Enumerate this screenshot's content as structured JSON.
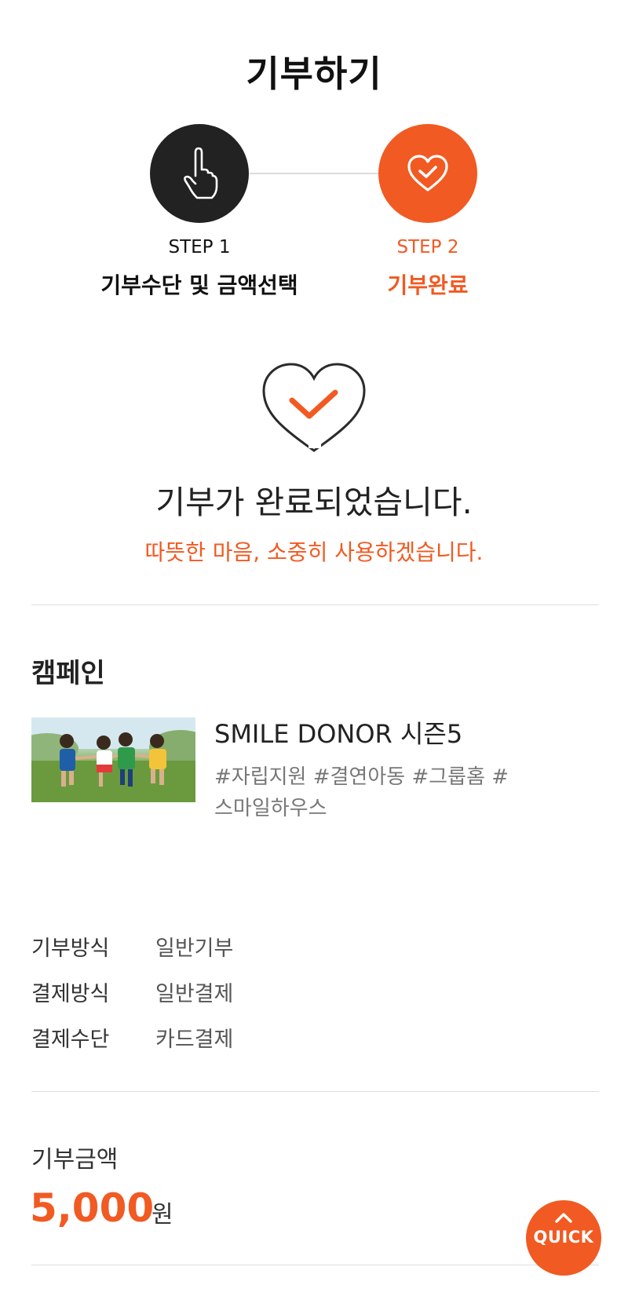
{
  "page": {
    "title": "기부하기"
  },
  "steps": [
    {
      "number": "STEP 1",
      "name": "기부수단 및 금액선택",
      "icon": "hand-pointer-icon"
    },
    {
      "number": "STEP 2",
      "name": "기부완료",
      "icon": "heart-check-icon"
    }
  ],
  "completion": {
    "icon": "heart-check-icon",
    "title": "기부가 완료되었습니다.",
    "subtitle": "따뜻한 마음, 소중히 사용하겠습니다."
  },
  "campaign": {
    "section_title": "캠페인",
    "name": "SMILE DONOR 시즌5",
    "tags_line1": "#자립지원 #결연아동 #그룹홈 #",
    "tags_line2": "스마일하우스"
  },
  "info": [
    {
      "label": "기부방식",
      "value": "일반기부"
    },
    {
      "label": "결제방식",
      "value": "일반결제"
    },
    {
      "label": "결제수단",
      "value": "카드결제"
    }
  ],
  "amount": {
    "label": "기부금액",
    "value": "5,000",
    "unit": "원"
  },
  "quick_button": {
    "label": "QUICK",
    "icon": "chevron-up-icon"
  },
  "colors": {
    "accent": "#f15a22",
    "dark": "#222222",
    "divider": "#dedede"
  }
}
